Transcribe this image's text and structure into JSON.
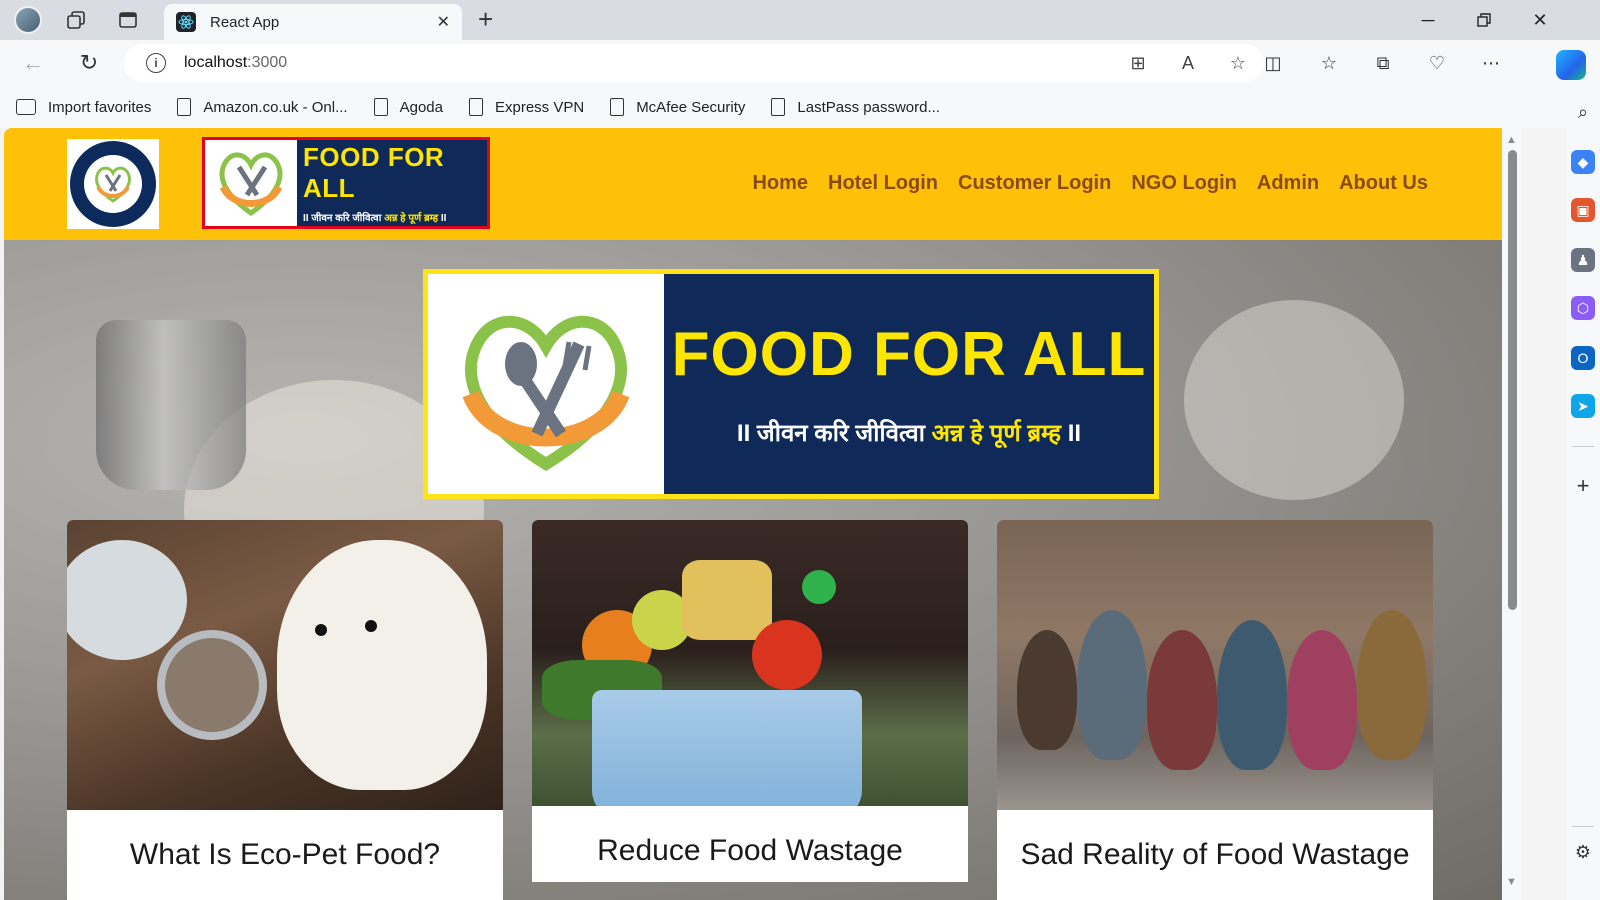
{
  "browser": {
    "tab_title": "React App",
    "url_host": "localhost",
    "url_port": ":3000",
    "favorites": [
      {
        "label": "Import favorites"
      },
      {
        "label": "Amazon.co.uk - Onl..."
      },
      {
        "label": "Agoda"
      },
      {
        "label": "Express VPN"
      },
      {
        "label": "McAfee Security"
      },
      {
        "label": "LastPass password..."
      }
    ]
  },
  "site": {
    "header_bg": "#fec107",
    "nav": [
      {
        "label": "Home"
      },
      {
        "label": "Hotel Login"
      },
      {
        "label": "Customer Login"
      },
      {
        "label": "NGO Login"
      },
      {
        "label": "Admin"
      },
      {
        "label": "About Us"
      }
    ],
    "banner_title": "FOOD FOR ALL",
    "tagline_start": "II जीवन करि जीवित्वा",
    "tagline_highlight": "अन्न हे पूर्ण ब्रम्ह",
    "tagline_end": "II",
    "round_logo_text": "FOOD FOR ALL"
  },
  "cards": [
    {
      "title": "What Is Eco-Pet Food?"
    },
    {
      "title": "Reduce Food Wastage"
    },
    {
      "title": "Sad Reality of Food Wastage"
    }
  ]
}
